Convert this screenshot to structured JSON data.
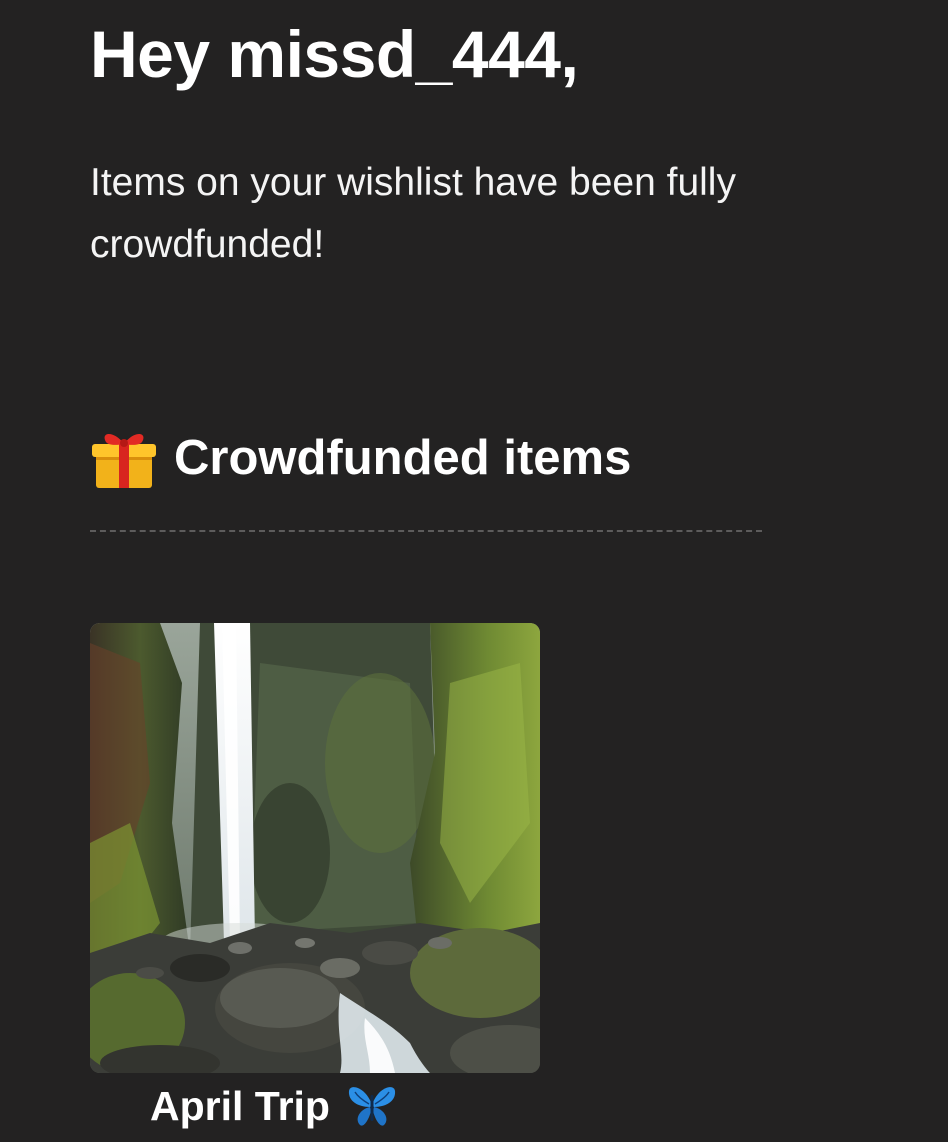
{
  "header": {
    "greeting": "Hey missd_444,",
    "message": "Items on your wishlist have been fully crowdfunded!"
  },
  "section": {
    "icon": "gift-icon",
    "title": "Crowdfunded items"
  },
  "items": [
    {
      "title": "April Trip",
      "icon": "butterfly-icon",
      "image": "waterfall-photo"
    }
  ],
  "colors": {
    "background": "#232222",
    "text": "#ffffff",
    "divider": "#5d5c5c"
  }
}
